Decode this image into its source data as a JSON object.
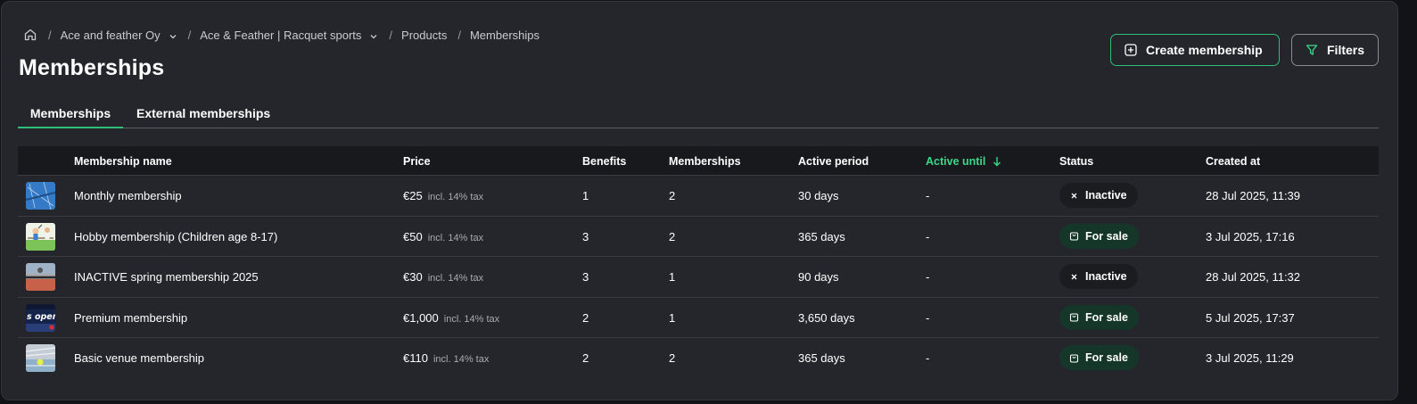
{
  "breadcrumb": {
    "home_icon": "home-icon",
    "items": [
      {
        "label": "Ace and feather Oy",
        "dropdown": true
      },
      {
        "label": "Ace & Feather | Racquet sports",
        "dropdown": true
      },
      {
        "label": "Products",
        "dropdown": false
      },
      {
        "label": "Memberships",
        "dropdown": false
      }
    ],
    "separator": "/"
  },
  "page": {
    "title": "Memberships"
  },
  "actions": {
    "create_label": "Create membership",
    "create_icon": "plus-square-icon",
    "filters_label": "Filters",
    "filters_icon": "filter-icon"
  },
  "tabs": [
    {
      "label": "Memberships",
      "active": true
    },
    {
      "label": "External memberships",
      "active": false
    }
  ],
  "table": {
    "columns": {
      "name": "Membership name",
      "price": "Price",
      "benefits": "Benefits",
      "memberships": "Memberships",
      "active_period": "Active period",
      "active_until": "Active until",
      "status": "Status",
      "created_at": "Created at"
    },
    "sorted_column": "active_until",
    "sort_direction": "descending",
    "rows": [
      {
        "thumb": "tennis-court-blue",
        "name": "Monthly membership",
        "price": "€25",
        "tax": "incl. 14% tax",
        "benefits": "1",
        "memberships": "2",
        "active_period": "30 days",
        "active_until": "-",
        "status": "Inactive",
        "status_type": "inactive",
        "created_at": "28 Jul 2025, 11:39"
      },
      {
        "thumb": "kids-badminton",
        "name": "Hobby membership (Children age 8-17)",
        "price": "€50",
        "tax": "incl. 14% tax",
        "benefits": "3",
        "memberships": "2",
        "active_period": "365 days",
        "active_until": "-",
        "status": "For sale",
        "status_type": "forsale",
        "created_at": "3 Jul 2025, 17:16"
      },
      {
        "thumb": "clay-court-net",
        "name": "INACTIVE spring membership 2025",
        "price": "€30",
        "tax": "incl. 14% tax",
        "benefits": "3",
        "memberships": "1",
        "active_period": "90 days",
        "active_until": "-",
        "status": "Inactive",
        "status_type": "inactive",
        "created_at": "28 Jul 2025, 11:32"
      },
      {
        "thumb": "us-open",
        "name": "Premium membership",
        "price": "€1,000",
        "tax": "incl. 14% tax",
        "benefits": "2",
        "memberships": "1",
        "active_period": "3,650 days",
        "active_until": "-",
        "status": "For sale",
        "status_type": "forsale",
        "created_at": "5 Jul 2025, 17:37"
      },
      {
        "thumb": "indoor-venue",
        "name": "Basic venue membership",
        "price": "€110",
        "tax": "incl. 14% tax",
        "benefits": "2",
        "memberships": "2",
        "active_period": "365 days",
        "active_until": "-",
        "status": "For sale",
        "status_type": "forsale",
        "created_at": "3 Jul 2025, 11:29"
      }
    ],
    "thumb_text": {
      "us-open": "s open"
    }
  },
  "colors": {
    "accent": "#2fbf78",
    "sorted_header": "#3ad888",
    "for_sale_bg": "#15372a",
    "inactive_bg": "#1b1c20"
  }
}
